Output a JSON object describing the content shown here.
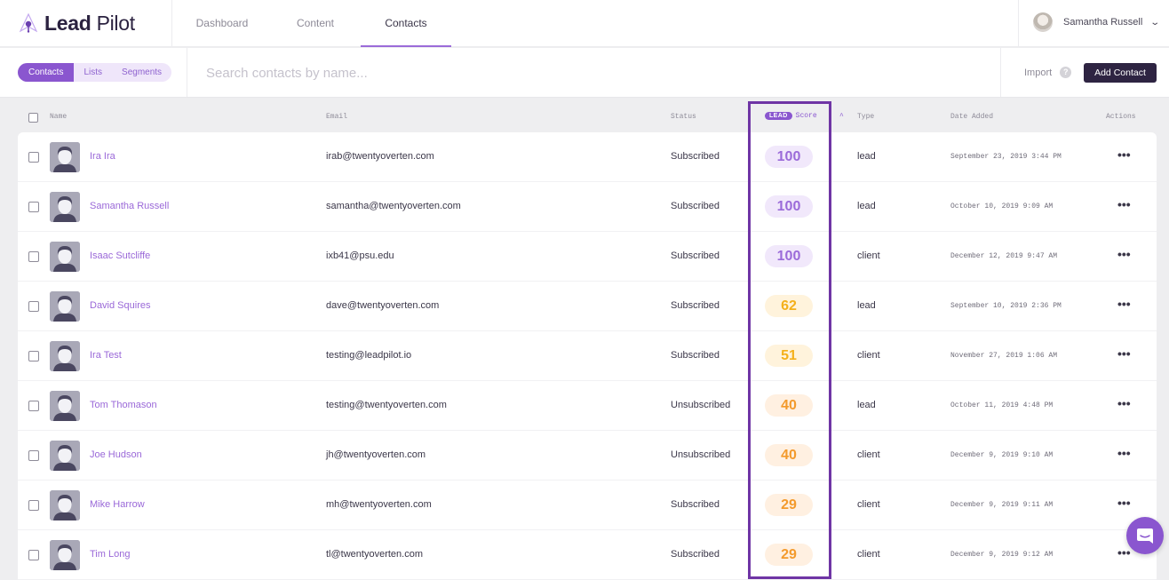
{
  "app": {
    "brand_bold": "Lead",
    "brand_light": " Pilot"
  },
  "nav": {
    "items": [
      {
        "label": "Dashboard"
      },
      {
        "label": "Content"
      },
      {
        "label": "Contacts",
        "active": true
      }
    ]
  },
  "user": {
    "name": "Samantha Russell"
  },
  "toolbar": {
    "segments": [
      "Contacts",
      "Lists",
      "Segments"
    ],
    "active_segment": "Contacts",
    "search_placeholder": "Search contacts by name...",
    "search_value": "",
    "import_label": "Import",
    "help_glyph": "?",
    "add_contact_label": "Add Contact"
  },
  "table": {
    "headers": {
      "name": "Name",
      "email": "Email",
      "status": "Status",
      "score_badge": "LEAD",
      "score": "Score",
      "sort_glyph": "^",
      "type": "Type",
      "date_added": "Date Added",
      "actions": "Actions"
    },
    "rows": [
      {
        "name": "Ira Ira",
        "email": "irab@twentyoverten.com",
        "status": "Subscribed",
        "score": "100",
        "score_level": "high",
        "type": "lead",
        "date": "September 23, 2019 3:44 PM"
      },
      {
        "name": "Samantha Russell",
        "email": "samantha@twentyoverten.com",
        "status": "Subscribed",
        "score": "100",
        "score_level": "high",
        "type": "lead",
        "date": "October 10, 2019 9:09 AM"
      },
      {
        "name": "Isaac Sutcliffe",
        "email": "ixb41@psu.edu",
        "status": "Subscribed",
        "score": "100",
        "score_level": "high",
        "type": "client",
        "date": "December 12, 2019 9:47 AM"
      },
      {
        "name": "David Squires",
        "email": "dave@twentyoverten.com",
        "status": "Subscribed",
        "score": "62",
        "score_level": "mid",
        "type": "lead",
        "date": "September 10, 2019 2:36 PM"
      },
      {
        "name": "Ira Test",
        "email": "testing@leadpilot.io",
        "status": "Subscribed",
        "score": "51",
        "score_level": "mid",
        "type": "client",
        "date": "November 27, 2019 1:06 AM"
      },
      {
        "name": "Tom Thomason",
        "email": "testing@twentyoverten.com",
        "status": "Unsubscribed",
        "score": "40",
        "score_level": "low",
        "type": "lead",
        "date": "October 11, 2019 4:48 PM"
      },
      {
        "name": "Joe Hudson",
        "email": "jh@twentyoverten.com",
        "status": "Unsubscribed",
        "score": "40",
        "score_level": "low",
        "type": "client",
        "date": "December 9, 2019 9:10 AM"
      },
      {
        "name": "Mike Harrow",
        "email": "mh@twentyoverten.com",
        "status": "Subscribed",
        "score": "29",
        "score_level": "low",
        "type": "client",
        "date": "December 9, 2019 9:11 AM"
      },
      {
        "name": "Tim Long",
        "email": "tl@twentyoverten.com",
        "status": "Subscribed",
        "score": "29",
        "score_level": "low",
        "type": "client",
        "date": "December 9, 2019 9:12 AM"
      }
    ],
    "actions_glyph": "•••"
  },
  "colors": {
    "accent": "#8a56cf",
    "highlight_border": "#6f35a5",
    "primary_button": "#2e2442",
    "score_high": "#9b6bd9",
    "score_mid": "#f4b01b",
    "score_low": "#f39a2c"
  }
}
